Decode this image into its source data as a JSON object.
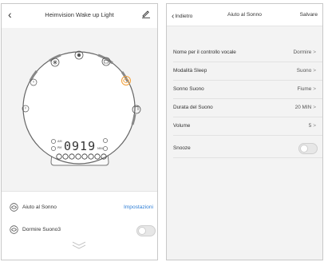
{
  "left": {
    "header": {
      "back_icon": "chevron-left-icon",
      "title": "Heimvision Wake up Light",
      "edit_icon": "pencil-icon"
    },
    "clock": {
      "time_display": "0919",
      "am": "AM",
      "pm": "PM",
      "min": "MIN"
    },
    "rows": {
      "aiuto_label": "Aiuto al Sonno",
      "impostazioni_link": "Impostazioni",
      "dormire_label": "Dormire Suono3",
      "dormire_toggle_on": false
    }
  },
  "right": {
    "header": {
      "back_label": "Indietro",
      "title": "Aiuto al Sonno",
      "save_label": "Salvare"
    },
    "settings": [
      {
        "label": "Nome per il controllo vocale",
        "value": "Dormire"
      },
      {
        "label": "Modalità Sleep",
        "value": "Suono"
      },
      {
        "label": "Sonno Suono",
        "value": "Fiume"
      },
      {
        "label": "Durata del Suono",
        "value": "20 MIN"
      },
      {
        "label": "Volume",
        "value": "5"
      }
    ],
    "snooze": {
      "label": "Snooze",
      "on": false
    },
    "chevron_glyph": ">"
  },
  "colors": {
    "accent_blue": "#2f7fd6",
    "orange_icon": "#f2a03a",
    "panel_bg": "#f3f3f3"
  }
}
